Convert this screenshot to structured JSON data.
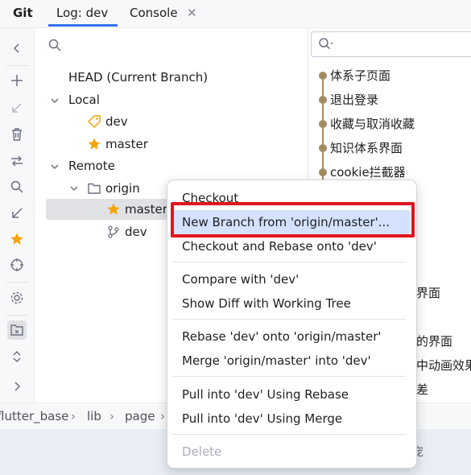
{
  "tabs": {
    "git": "Git",
    "log": "Log: dev",
    "console": "Console",
    "close_glyph": "✕"
  },
  "branches": {
    "head": "HEAD (Current Branch)",
    "local": "Local",
    "local_dev": "dev",
    "local_master": "master",
    "remote": "Remote",
    "origin": "origin",
    "origin_master": "master",
    "origin_dev": "dev"
  },
  "commits": [
    "体系子页面",
    "退出登录",
    "收藏与取消收藏",
    "知识体系界面",
    "cookie拦截器"
  ],
  "commits_partial": {
    "a": "界面",
    "b": "的界面",
    "c": "中动画效果",
    "d": "差"
  },
  "breadcrumb": {
    "c1": "flutter_base",
    "c2": "lib",
    "c3": "page",
    "sep": "›"
  },
  "bottom": {
    "partial": "宠"
  },
  "menu": {
    "checkout": "Checkout",
    "new_branch": "New Branch from 'origin/master'...",
    "checkout_rebase": "Checkout and Rebase onto 'dev'",
    "compare": "Compare with 'dev'",
    "show_diff": "Show Diff with Working Tree",
    "rebase": "Rebase 'dev' onto 'origin/master'",
    "merge": "Merge 'origin/master' into 'dev'",
    "pull_rebase": "Pull into 'dev' Using Rebase",
    "pull_merge": "Pull into 'dev' Using Merge",
    "delete": "Delete"
  },
  "colors": {
    "accent": "#3574f0",
    "menu_highlight": "#d4e2ff",
    "annotation_red": "#e2151d",
    "graph": "#a38a62",
    "star": "#f4a402"
  }
}
